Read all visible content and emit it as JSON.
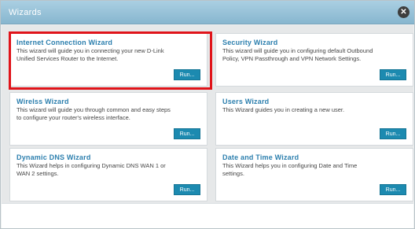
{
  "window": {
    "title": "Wizards",
    "close_icon": "close-icon",
    "close_glyph": "✕"
  },
  "accent_color": "#1c8ab0",
  "highlight_color": "#e0141a",
  "cards": [
    {
      "title": "Internet Connection Wizard",
      "description": "This wizard will guide you in connecting your new D-Link Unified Services Router to the Internet.",
      "button_label": "Run..."
    },
    {
      "title": "Security Wizard",
      "description": "This wizard will guide you in configuring default Outbound Policy, VPN Passthrough and VPN Network Settings.",
      "button_label": "Run..."
    },
    {
      "title": "Wirelss Wizard",
      "description": "This wizard will guide you through common and easy steps to configure your router's wireless interface.",
      "button_label": "Run..."
    },
    {
      "title": "Users Wizard",
      "description": "This Wizard guides you in creating a new user.",
      "button_label": "Run..."
    },
    {
      "title": "Dynamic DNS Wizard",
      "description": "This Wizard helps in configuring Dynamic DNS WAN 1 or WAN 2 settings.",
      "button_label": "Run..."
    },
    {
      "title": "Date and Time Wizard",
      "description": "This Wizard helps you in configuring Date and Time settings.",
      "button_label": "Run..."
    }
  ]
}
